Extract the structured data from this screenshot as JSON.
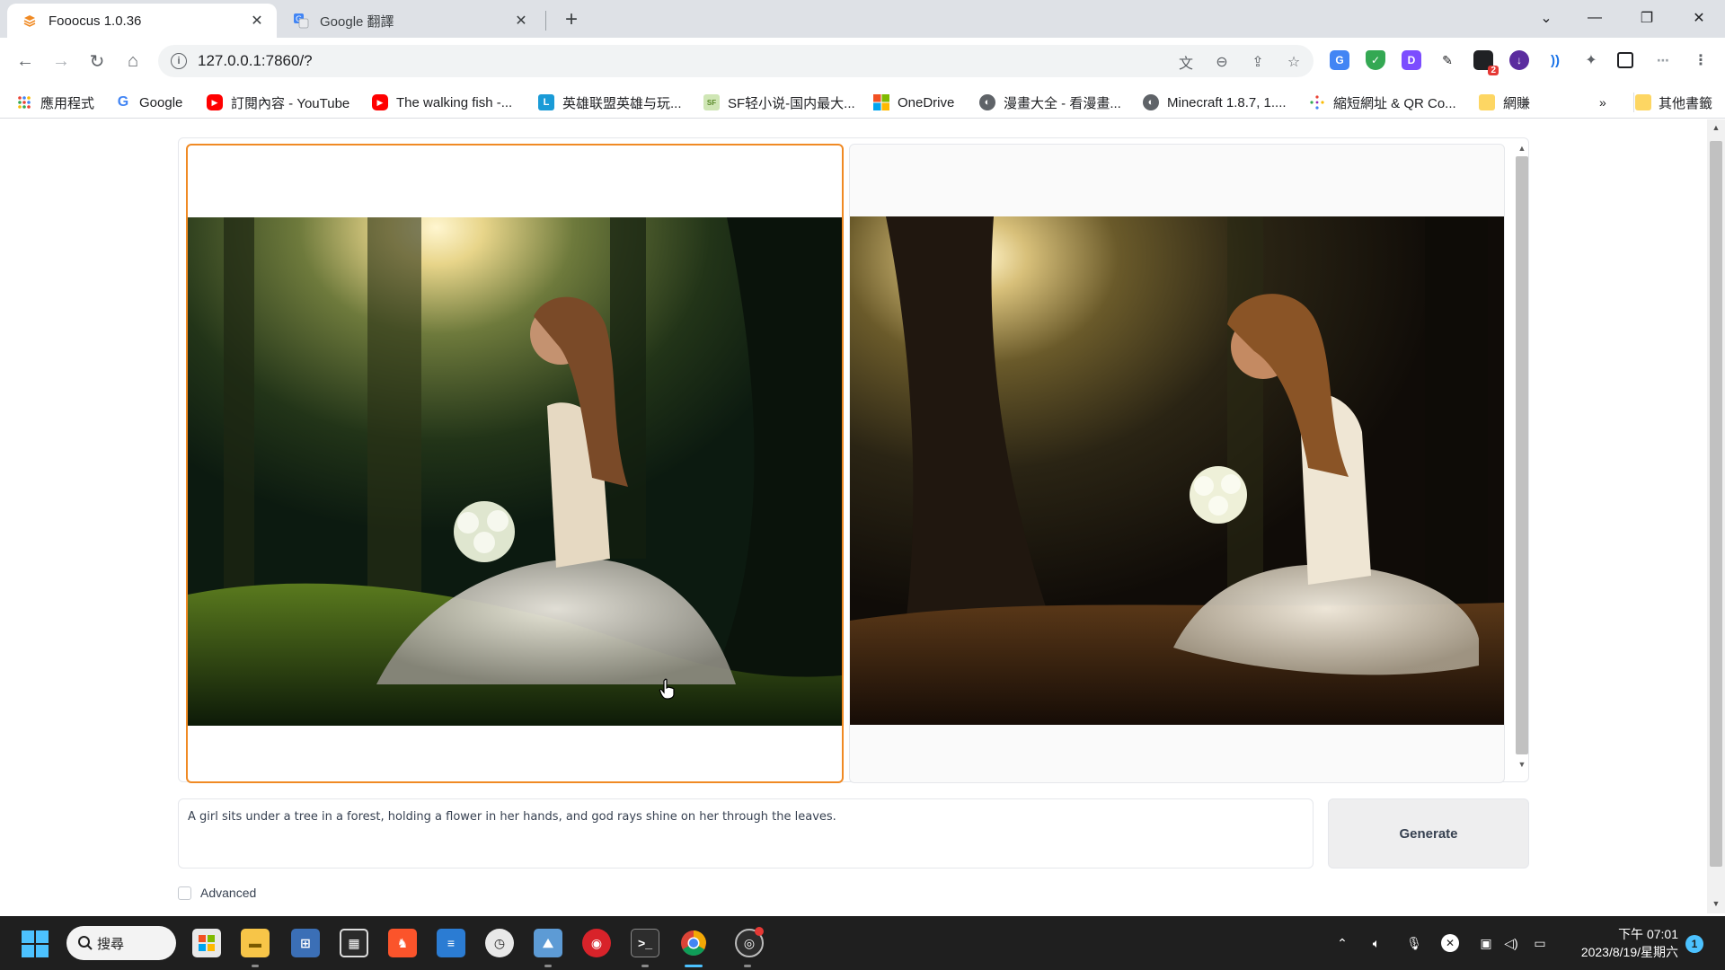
{
  "browser": {
    "tabs": [
      {
        "title": "Fooocus 1.0.36",
        "icon": "fooocus-icon",
        "active": true
      },
      {
        "title": "Google 翻譯",
        "icon": "google-translate-icon",
        "active": false
      }
    ],
    "url": "127.0.0.1:7860/?",
    "bookmarks": [
      {
        "label": "應用程式",
        "icon": "apps-grid-icon"
      },
      {
        "label": "Google",
        "icon": "google-icon"
      },
      {
        "label": "訂閱內容 - YouTube",
        "icon": "youtube-icon"
      },
      {
        "label": "The walking fish -...",
        "icon": "youtube-icon"
      },
      {
        "label": "英雄联盟英雄与玩...",
        "icon": "l-icon"
      },
      {
        "label": "SF轻小说-国内最大...",
        "icon": "sf-icon"
      },
      {
        "label": "OneDrive",
        "icon": "microsoft-icon"
      },
      {
        "label": "漫畫大全 - 看漫畫...",
        "icon": "globe-icon"
      },
      {
        "label": "Minecraft 1.8.7, 1....",
        "icon": "globe-icon"
      },
      {
        "label": "縮短網址 & QR Co...",
        "icon": "dots-icon"
      },
      {
        "label": "網賺",
        "icon": "folder-icon"
      },
      {
        "label": "其他書籤",
        "icon": "folder-icon"
      }
    ],
    "overflow_label": "»",
    "extension_badge": "2"
  },
  "app": {
    "prompt": "A girl sits under a tree in a forest, holding a flower in her hands, and god rays shine on her through the leaves.",
    "generate_label": "Generate",
    "advanced_label": "Advanced",
    "advanced_checked": false,
    "gallery_selected_index": 0,
    "accent": "#f08a24"
  },
  "taskbar": {
    "search_label": "搜尋",
    "time": "下午 07:01",
    "date": "2023/8/19/星期六",
    "notification_count": "1"
  }
}
